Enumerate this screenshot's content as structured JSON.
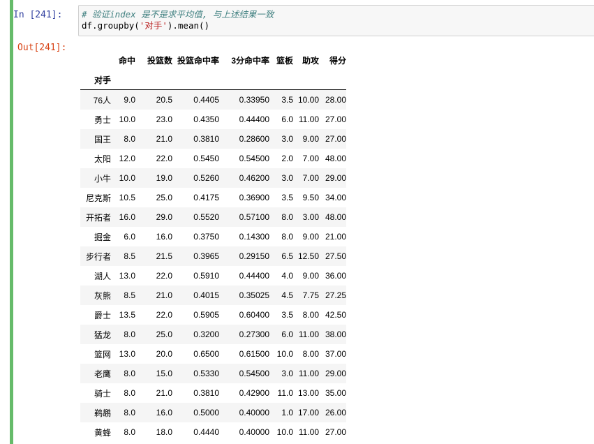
{
  "input_prompt": "In  [241]:",
  "output_prompt": "Out[241]:",
  "code": {
    "comment": "# 验证index 是不是求平均值, 与上述结果一致",
    "line2_pre": "df.groupby(",
    "line2_str": "'对手'",
    "line2_post": ").mean()"
  },
  "table": {
    "index_name": "对手",
    "columns": [
      "命中",
      "投篮数",
      "投篮命中率",
      "3分命中率",
      "篮板",
      "助攻",
      "得分"
    ],
    "rows": [
      {
        "index": "76人",
        "values": [
          "9.0",
          "20.5",
          "0.4405",
          "0.33950",
          "3.5",
          "10.00",
          "28.00"
        ]
      },
      {
        "index": "勇士",
        "values": [
          "10.0",
          "23.0",
          "0.4350",
          "0.44400",
          "6.0",
          "11.00",
          "27.00"
        ]
      },
      {
        "index": "国王",
        "values": [
          "8.0",
          "21.0",
          "0.3810",
          "0.28600",
          "3.0",
          "9.00",
          "27.00"
        ]
      },
      {
        "index": "太阳",
        "values": [
          "12.0",
          "22.0",
          "0.5450",
          "0.54500",
          "2.0",
          "7.00",
          "48.00"
        ]
      },
      {
        "index": "小牛",
        "values": [
          "10.0",
          "19.0",
          "0.5260",
          "0.46200",
          "3.0",
          "7.00",
          "29.00"
        ]
      },
      {
        "index": "尼克斯",
        "values": [
          "10.5",
          "25.0",
          "0.4175",
          "0.36900",
          "3.5",
          "9.50",
          "34.00"
        ]
      },
      {
        "index": "开拓者",
        "values": [
          "16.0",
          "29.0",
          "0.5520",
          "0.57100",
          "8.0",
          "3.00",
          "48.00"
        ]
      },
      {
        "index": "掘金",
        "values": [
          "6.0",
          "16.0",
          "0.3750",
          "0.14300",
          "8.0",
          "9.00",
          "21.00"
        ]
      },
      {
        "index": "步行者",
        "values": [
          "8.5",
          "21.5",
          "0.3965",
          "0.29150",
          "6.5",
          "12.50",
          "27.50"
        ]
      },
      {
        "index": "湖人",
        "values": [
          "13.0",
          "22.0",
          "0.5910",
          "0.44400",
          "4.0",
          "9.00",
          "36.00"
        ]
      },
      {
        "index": "灰熊",
        "values": [
          "8.5",
          "21.0",
          "0.4015",
          "0.35025",
          "4.5",
          "7.75",
          "27.25"
        ]
      },
      {
        "index": "爵士",
        "values": [
          "13.5",
          "22.0",
          "0.5905",
          "0.60400",
          "3.5",
          "8.00",
          "42.50"
        ]
      },
      {
        "index": "猛龙",
        "values": [
          "8.0",
          "25.0",
          "0.3200",
          "0.27300",
          "6.0",
          "11.00",
          "38.00"
        ]
      },
      {
        "index": "篮网",
        "values": [
          "13.0",
          "20.0",
          "0.6500",
          "0.61500",
          "10.0",
          "8.00",
          "37.00"
        ]
      },
      {
        "index": "老鹰",
        "values": [
          "8.0",
          "15.0",
          "0.5330",
          "0.54500",
          "3.0",
          "11.00",
          "29.00"
        ]
      },
      {
        "index": "骑士",
        "values": [
          "8.0",
          "21.0",
          "0.3810",
          "0.42900",
          "11.0",
          "13.00",
          "35.00"
        ]
      },
      {
        "index": "鹈鹕",
        "values": [
          "8.0",
          "16.0",
          "0.5000",
          "0.40000",
          "1.0",
          "17.00",
          "26.00"
        ]
      },
      {
        "index": "黄蜂",
        "values": [
          "8.0",
          "18.0",
          "0.4440",
          "0.40000",
          "10.0",
          "11.00",
          "27.00"
        ]
      }
    ]
  }
}
